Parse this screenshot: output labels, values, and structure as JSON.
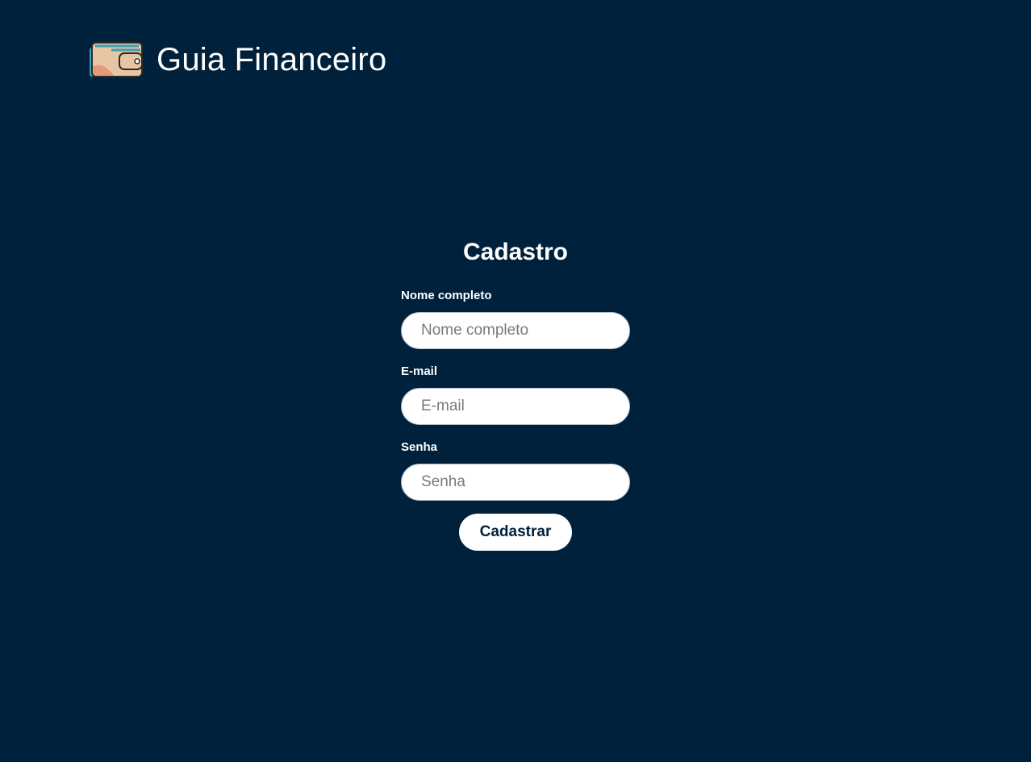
{
  "header": {
    "app_title": "Guia Financeiro",
    "logo_icon": "wallet-icon"
  },
  "form": {
    "title": "Cadastro",
    "fields": [
      {
        "label": "Nome completo",
        "placeholder": "Nome completo",
        "value": ""
      },
      {
        "label": "E-mail",
        "placeholder": "E-mail",
        "value": ""
      },
      {
        "label": "Senha",
        "placeholder": "Senha",
        "value": ""
      }
    ],
    "submit_label": "Cadastrar"
  },
  "colors": {
    "background": "#00213b",
    "text": "#ffffff",
    "input_background": "#ffffff",
    "button_text": "#00213b"
  }
}
